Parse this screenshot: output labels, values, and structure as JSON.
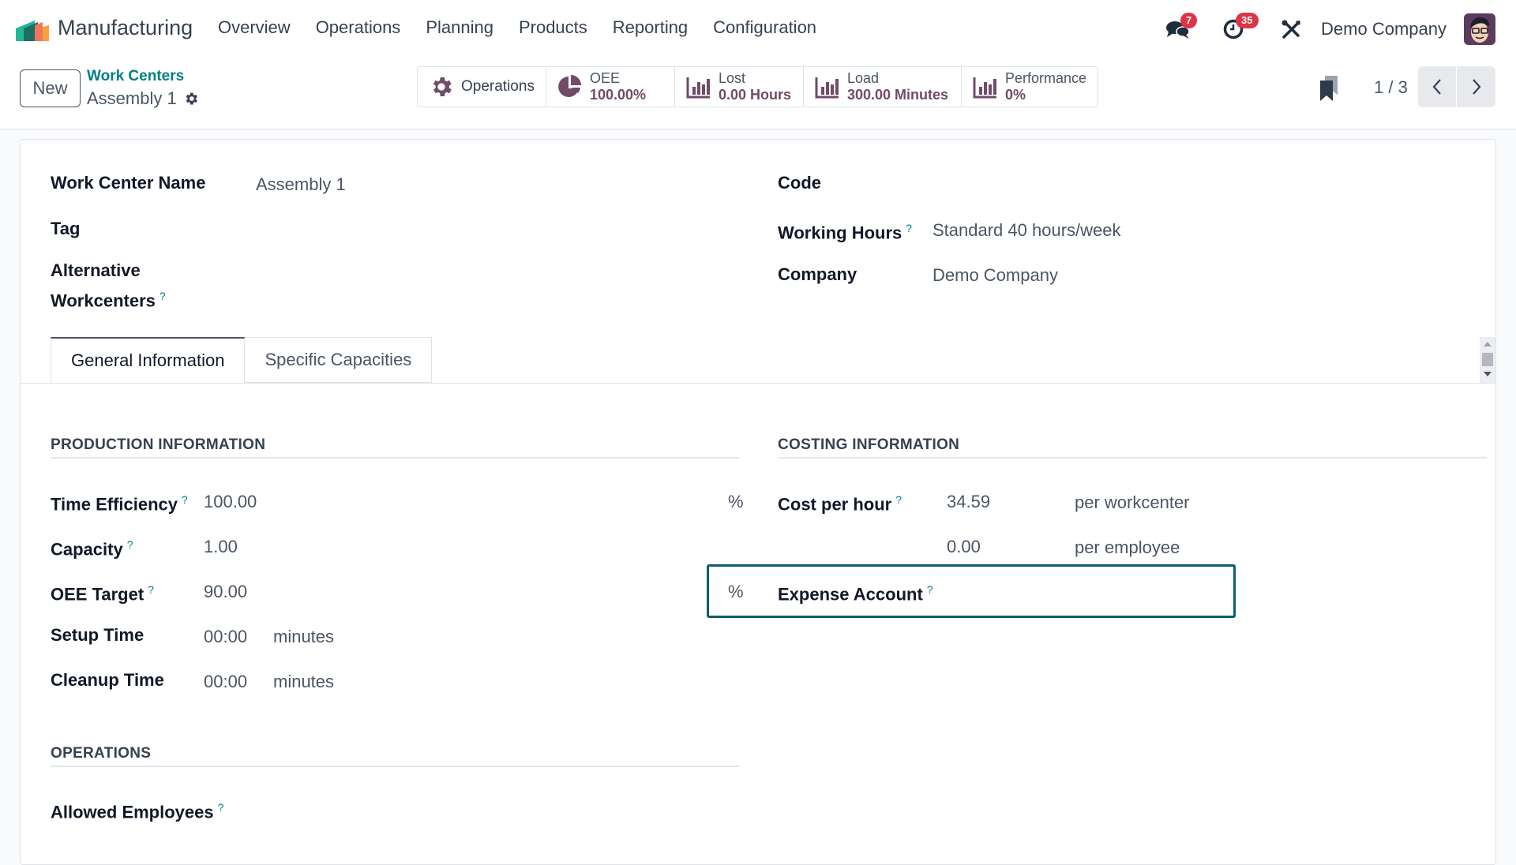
{
  "navbar": {
    "app_name": "Manufacturing",
    "menu": [
      "Overview",
      "Operations",
      "Planning",
      "Products",
      "Reporting",
      "Configuration"
    ],
    "messages_count": "7",
    "activities_count": "35",
    "company": "Demo Company"
  },
  "control_panel": {
    "new_label": "New",
    "breadcrumb_parent": "Work Centers",
    "breadcrumb_current": "Assembly 1",
    "smart_buttons": {
      "operations": "Operations",
      "oee_label": "OEE",
      "oee_value": "100.00%",
      "lost_label": "Lost",
      "lost_value": "0.00 Hours",
      "load_label": "Load",
      "load_value": "300.00 Minutes",
      "performance_label": "Performance",
      "performance_value": "0%"
    },
    "pager": "1 / 3"
  },
  "form": {
    "work_center_name_label": "Work Center Name",
    "work_center_name_value": "Assembly 1",
    "tag_label": "Tag",
    "alt_workcenters_label_1": "Alternative",
    "alt_workcenters_label_2": "Workcenters",
    "code_label": "Code",
    "working_hours_label": "Working Hours",
    "working_hours_value": "Standard 40 hours/week",
    "company_label": "Company",
    "company_value": "Demo Company",
    "help_mark": "?",
    "tabs": [
      "General Information",
      "Specific Capacities"
    ],
    "production": {
      "title": "PRODUCTION INFORMATION",
      "time_efficiency_label": "Time Efficiency",
      "time_efficiency_value": "100.00",
      "percent": "%",
      "capacity_label": "Capacity",
      "capacity_value": "1.00",
      "oee_target_label": "OEE Target",
      "oee_target_value": "90.00",
      "setup_time_label": "Setup Time",
      "setup_time_value": "00:00",
      "cleanup_time_label": "Cleanup Time",
      "cleanup_time_value": "00:00",
      "minutes": "minutes"
    },
    "costing": {
      "title": "COSTING INFORMATION",
      "cost_per_hour_label": "Cost per hour",
      "cost_per_hour_value": "34.59",
      "per_workcenter": "per workcenter",
      "employee_cost_value": "0.00",
      "per_employee": "per employee",
      "expense_account_label": "Expense Account",
      "expense_percent": "%"
    },
    "operations": {
      "title": "OPERATIONS",
      "allowed_employees_label": "Allowed Employees"
    }
  },
  "colors": {
    "brand_primary": "#714b67",
    "link_teal": "#017e84",
    "badge_red": "#dc3545",
    "focus_border": "#0e5e6f"
  }
}
